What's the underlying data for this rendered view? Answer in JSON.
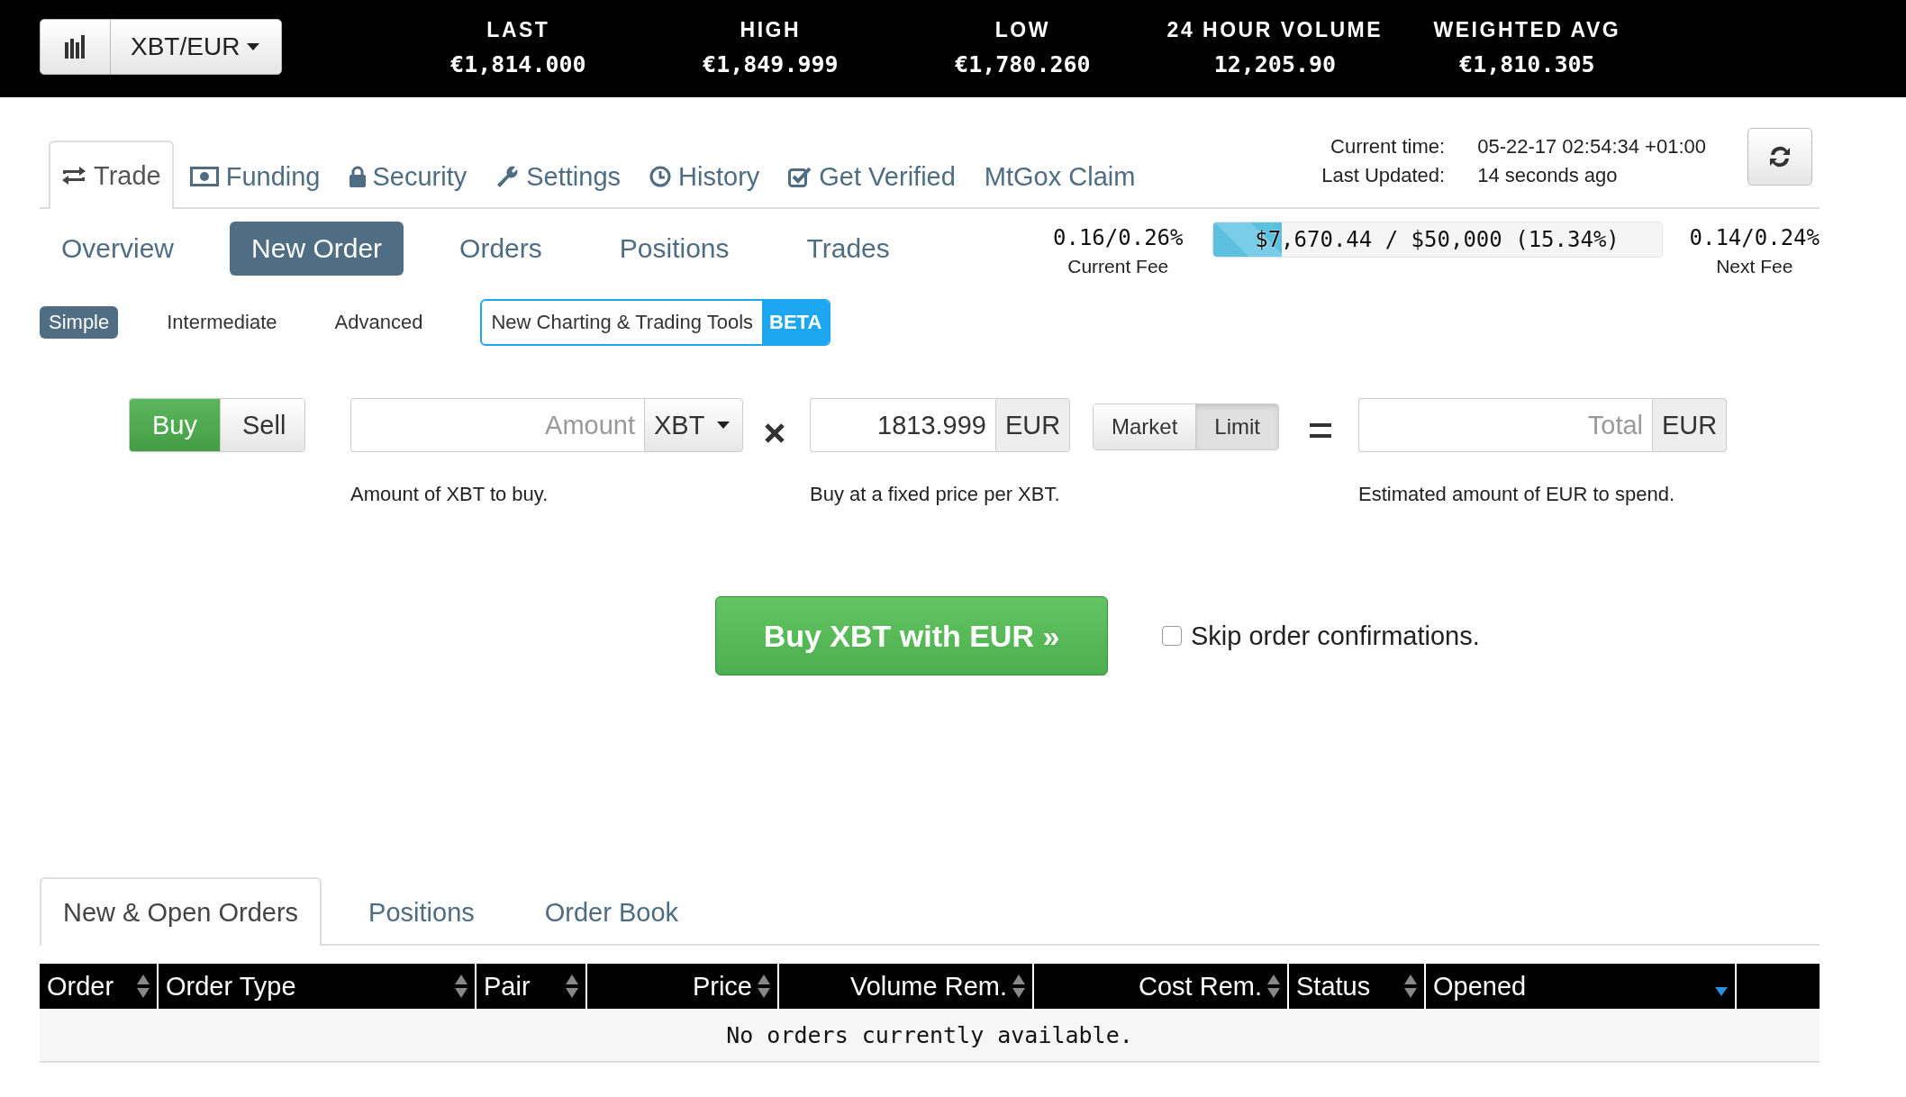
{
  "market_selector": {
    "pair": "XBT/EUR"
  },
  "ticker": [
    {
      "label": "LAST",
      "value": "€1,814.000"
    },
    {
      "label": "HIGH",
      "value": "€1,849.999"
    },
    {
      "label": "LOW",
      "value": "€1,780.260"
    },
    {
      "label": "24 HOUR VOLUME",
      "value": "12,205.90"
    },
    {
      "label": "WEIGHTED AVG",
      "value": "€1,810.305"
    }
  ],
  "main_tabs": [
    {
      "label": "Trade",
      "selected": true
    },
    {
      "label": "Funding",
      "selected": false
    },
    {
      "label": "Security",
      "selected": false
    },
    {
      "label": "Settings",
      "selected": false
    },
    {
      "label": "History",
      "selected": false
    },
    {
      "label": "Get Verified",
      "selected": false
    },
    {
      "label": "MtGox Claim",
      "selected": false
    }
  ],
  "clock": {
    "current_time_label": "Current time:",
    "current_time": "05-22-17 02:54:34 +01:00",
    "last_updated_label": "Last Updated:",
    "last_updated": "14 seconds ago"
  },
  "sub_tabs": [
    {
      "label": "Overview",
      "selected": false
    },
    {
      "label": "New Order",
      "selected": true
    },
    {
      "label": "Orders",
      "selected": false
    },
    {
      "label": "Positions",
      "selected": false
    },
    {
      "label": "Trades",
      "selected": false
    }
  ],
  "fees": {
    "current_fee": "0.16/0.26%",
    "current_fee_label": "Current Fee",
    "volume_text": "$7,670.44 / $50,000 (15.34%)",
    "level": 0.1534,
    "next_fee": "0.14/0.24%",
    "next_fee_label": "Next Fee"
  },
  "modes": [
    {
      "label": "Simple",
      "selected": true
    },
    {
      "label": "Intermediate",
      "selected": false
    },
    {
      "label": "Advanced",
      "selected": false
    }
  ],
  "charting_link": {
    "label": "New Charting & Trading Tools",
    "badge": "BETA"
  },
  "side": [
    {
      "label": "Buy",
      "selected": true
    },
    {
      "label": "Sell",
      "selected": false
    }
  ],
  "amount": {
    "placeholder": "Amount",
    "currency": "XBT",
    "hint": "Amount of XBT to buy."
  },
  "price": {
    "value": "1813.999",
    "currency": "EUR",
    "hint": "Buy at a fixed price per XBT."
  },
  "order_types": [
    {
      "label": "Market",
      "selected": false
    },
    {
      "label": "Limit",
      "selected": true
    }
  ],
  "total": {
    "placeholder": "Total",
    "currency": "EUR",
    "hint": "Estimated amount of EUR to spend."
  },
  "submit": {
    "label": "Buy XBT with EUR »"
  },
  "skip_confirmations": {
    "label": "Skip order confirmations.",
    "checked": false
  },
  "bottom_tabs": [
    {
      "label": "New & Open Orders",
      "selected": true
    },
    {
      "label": "Positions",
      "selected": false
    },
    {
      "label": "Order Book",
      "selected": false
    }
  ],
  "orders_table": {
    "columns": [
      {
        "label": "Order",
        "kind": "text",
        "sorted": false
      },
      {
        "label": "Order Type",
        "kind": "text",
        "sorted": false
      },
      {
        "label": "Pair",
        "kind": "text",
        "sorted": false
      },
      {
        "label": "Price",
        "kind": "number",
        "sorted": false
      },
      {
        "label": "Volume Rem.",
        "kind": "number",
        "sorted": false
      },
      {
        "label": "Cost Rem.",
        "kind": "number",
        "sorted": false
      },
      {
        "label": "Status",
        "kind": "text",
        "sorted": false
      },
      {
        "label": "Opened",
        "kind": "text",
        "sorted": true
      }
    ],
    "empty_message": "No orders currently available."
  }
}
